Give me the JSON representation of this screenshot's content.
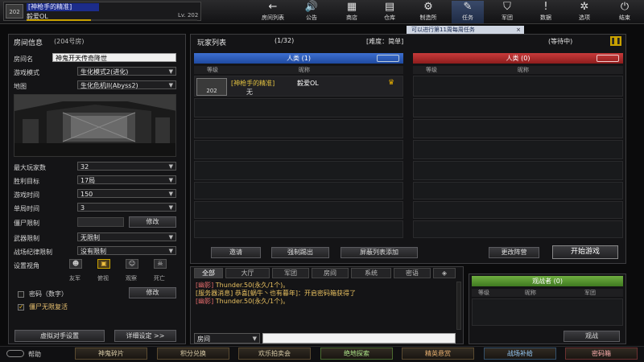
{
  "profile": {
    "rank_label": "202",
    "clan": "[神枪手的精准]",
    "name": "毅爱OL",
    "level": "Lv. 202"
  },
  "nav": [
    {
      "label": "房间列表",
      "icon": "←"
    },
    {
      "label": "公告",
      "icon": "🔊"
    },
    {
      "label": "商店",
      "icon": "▦"
    },
    {
      "label": "仓库",
      "icon": "▤"
    },
    {
      "label": "制造所",
      "icon": "⚙"
    },
    {
      "label": "任务",
      "icon": "✎"
    },
    {
      "label": "军团",
      "icon": "⛉"
    },
    {
      "label": "数据",
      "icon": "!"
    },
    {
      "label": "选项",
      "icon": "✲"
    },
    {
      "label": "结束",
      "icon": "⏻"
    }
  ],
  "task_banner": {
    "text": "可以进行第11周每周任务",
    "close": "×"
  },
  "room": {
    "title": "房间信息",
    "room_no": "(204号房)",
    "name_label": "房间名",
    "name_value": "神鬼开天传奇降世",
    "mode_label": "游戏模式",
    "mode_value": "生化模式2(进化)",
    "map_label": "地图",
    "map_value": "生化危机II(Abyss2)",
    "rows": [
      {
        "label": "最大玩家数",
        "value": "32"
      },
      {
        "label": "胜利目标",
        "value": "17局"
      },
      {
        "label": "游戏时间",
        "value": "150"
      },
      {
        "label": "单局时间",
        "value": "3"
      }
    ],
    "zombie_limit_label": "僵尸限制",
    "zombie_limit_btn": "修改",
    "weapon_limit_label": "武器限制",
    "weapon_limit_value": "无限制",
    "discipline_label": "战场纪律限制",
    "discipline_value": "没有限制",
    "view_label": "设置视角",
    "views": [
      "友军",
      "俯视",
      "观察",
      "死亡"
    ],
    "password_label": "密码（数字）",
    "password_btn": "修改",
    "unlimited_label": "僵尸无限复活",
    "virtual_btn": "虚拟对手设置",
    "detail_btn": "详细设定 >>"
  },
  "players": {
    "title": "玩家列表",
    "count": "(1/32)",
    "difficulty": "[难度：简单]",
    "status": "(等待中)",
    "human_header": "人类 (1)",
    "zombie_header": "人类 (0)",
    "col_level": "等级",
    "col_name": "昵称",
    "player": {
      "rank": "202",
      "clan": "[神枪手的精准]",
      "name": "毅爱OL",
      "tag": "无"
    },
    "btn_invite": "邀请",
    "btn_kick": "强制踢出",
    "btn_block": "屏蔽列表添加",
    "btn_change": "更改阵营",
    "btn_start": "开始游戏"
  },
  "chat": {
    "tabs": [
      "全部",
      "大厅",
      "军团",
      "房间",
      "系统",
      "密语"
    ],
    "lines": [
      {
        "prefix": "[幽影]",
        "text": " Thunder.50(永久/1个)。"
      },
      {
        "prefix": "[服务器消息]",
        "text": " 恭喜[蜗牛丶也有暮年]：开启密码箱获得了"
      },
      {
        "prefix": "[幽影]",
        "text": " Thunder.50(永久/1个)。"
      }
    ],
    "channel": "房间"
  },
  "spectators": {
    "header": "观战者 (0)",
    "col_level": "等级",
    "col_name": "昵称",
    "col_clan": "军团",
    "btn": "观战"
  },
  "footer": {
    "help": "帮助",
    "buttons": [
      "神鬼碎片",
      "积分兑换",
      "欢乐拍卖会",
      "绝地探索",
      "精英悬赏",
      "战场补给",
      "密码箱"
    ]
  },
  "colors": {
    "human": "#2a5cb8",
    "zombie": "#b02a2a",
    "gold": "#d8a000",
    "accent": "#e06a6a"
  }
}
